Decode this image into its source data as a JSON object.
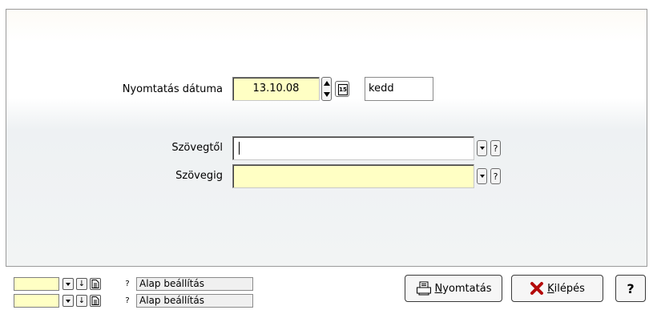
{
  "form": {
    "print_date_label": "Nyomtatás dátuma",
    "print_date_value": "13.10.08",
    "day_name": "kedd",
    "calendar_icon_text": "15",
    "text_from_label": "Szövegtől",
    "text_to_label": "Szövegig",
    "help_glyph": "?"
  },
  "footer": {
    "rows": [
      {
        "preset_label": "Alap beállítás"
      },
      {
        "preset_label": "Alap beállítás"
      }
    ],
    "print_button": {
      "underline": "N",
      "rest": "yomtatás"
    },
    "exit_button": {
      "underline": "K",
      "rest": "ilépés"
    },
    "help_button": "?"
  },
  "icons": {
    "spin": "spin-updown-icon",
    "calendar": "calendar-icon",
    "dropdown": "dropdown-arrow-icon",
    "help": "question-icon",
    "printer": "printer-icon",
    "exit": "red-x-icon",
    "down_arrow": "down-arrow-icon",
    "document": "document-icon"
  }
}
